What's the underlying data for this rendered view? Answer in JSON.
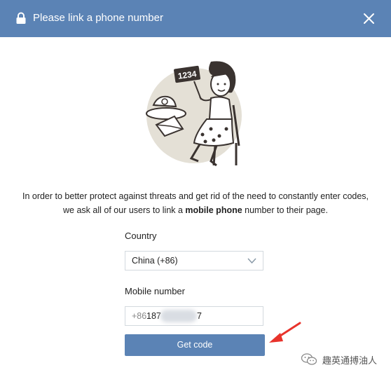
{
  "dialog": {
    "title": "Please link a phone number",
    "header_color": "#5b83b5"
  },
  "illustration": {
    "sign_text": "1234"
  },
  "description": {
    "line1": "In order to better protect against threats and get rid of the need to constantly enter codes,",
    "line2_pre": "we ask all of our users to link a ",
    "line2_bold": "mobile phone",
    "line2_post": " number to their page."
  },
  "form": {
    "country_label": "Country",
    "country_value": "China (+86)",
    "mobile_label": "Mobile number",
    "phone_prefix": "+86",
    "phone_value_start": "187",
    "phone_value_end": "7",
    "submit_label": "Get code"
  },
  "watermark": {
    "text": "趣英通搏油人"
  }
}
